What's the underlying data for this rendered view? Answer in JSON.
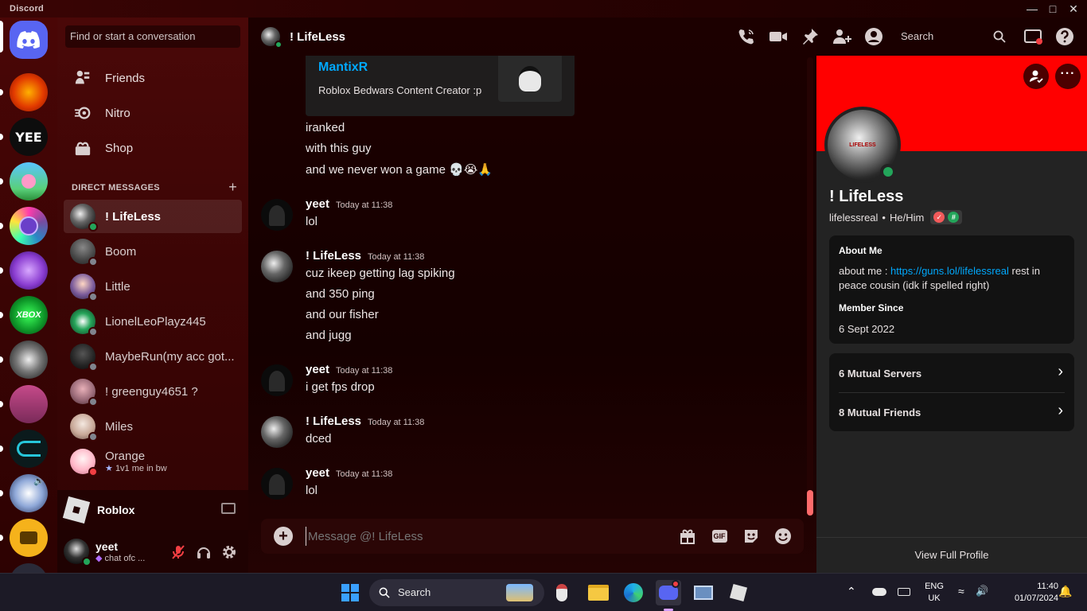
{
  "window": {
    "app_title": "Discord"
  },
  "sidebar": {
    "search_placeholder": "Find or start a conversation",
    "nav": [
      {
        "label": "Friends",
        "icon": "friends-icon"
      },
      {
        "label": "Nitro",
        "icon": "nitro-icon"
      },
      {
        "label": "Shop",
        "icon": "shop-icon"
      }
    ],
    "dm_header": "DIRECT MESSAGES",
    "dms": [
      {
        "name": "! LifeLess",
        "status": "online",
        "active": true
      },
      {
        "name": "Boom",
        "status": "offline"
      },
      {
        "name": "Little",
        "status": "offline"
      },
      {
        "name": "LionelLeoPlayz445",
        "status": "offline"
      },
      {
        "name": "MaybeRun(my acc got...",
        "status": "offline"
      },
      {
        "name": "! greenguy4651 ?",
        "status": "offline"
      },
      {
        "name": "Miles",
        "status": "offline"
      },
      {
        "name": "Orange",
        "status": "dnd",
        "sub": "1v1 me in bw"
      }
    ],
    "activity": {
      "name": "Roblox"
    },
    "user": {
      "name": "yeet",
      "status_text": "chat ofc ..."
    }
  },
  "chat": {
    "channel_name": "! LifeLess",
    "header_search": "Search",
    "embed": {
      "name": "MantixR",
      "description": "Roblox Bedwars Content Creator :p"
    },
    "top_lines": [
      "iranked",
      "with this guy",
      "and we never won a game 💀😭🙏"
    ],
    "messages": [
      {
        "author": "yeet",
        "time": "Today at 11:38",
        "lines": [
          "lol"
        ]
      },
      {
        "author": "! LifeLess",
        "time": "Today at 11:38",
        "lines": [
          "cuz ikeep getting lag spiking",
          "and 350 ping",
          "and our fisher",
          "and jugg"
        ]
      },
      {
        "author": "yeet",
        "time": "Today at 11:38",
        "lines": [
          "i get fps drop"
        ]
      },
      {
        "author": "! LifeLess",
        "time": "Today at 11:38",
        "lines": [
          "dced"
        ]
      },
      {
        "author": "yeet",
        "time": "Today at 11:38",
        "lines": [
          "lol"
        ]
      }
    ],
    "composer_placeholder": "Message @! LifeLess",
    "gif_label": "GIF"
  },
  "profile": {
    "display_name": "! LifeLess",
    "username": "lifelessreal",
    "pronouns": "He/Him",
    "separator": "•",
    "avatar_text": "LIFELESS",
    "about_title": "About Me",
    "about_prefix": "about me : ",
    "about_link": "https://guns.lol/lifelessreal",
    "about_suffix": " rest in peace cousin (idk if spelled right)",
    "member_since_title": "Member Since",
    "member_since": "6 Sept 2022",
    "mutual_servers": "6 Mutual Servers",
    "mutual_friends": "8 Mutual Friends",
    "view_full": "View Full Profile",
    "banner_color": "#ff0000"
  },
  "taskbar": {
    "search_label": "Search",
    "lang_top": "ENG",
    "lang_bottom": "UK",
    "time": "11:40",
    "date": "01/07/2024"
  },
  "colors": {
    "blurple": "#5865f2",
    "online": "#23a55a",
    "dnd": "#f23f43",
    "offline": "#80848e",
    "link": "#00a8fc"
  }
}
